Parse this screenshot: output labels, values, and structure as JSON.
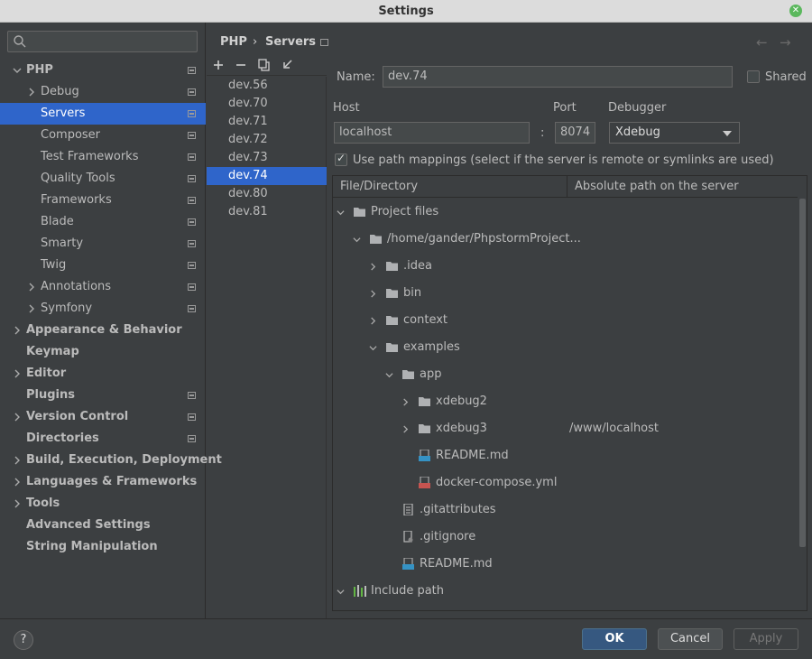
{
  "window": {
    "title": "Settings"
  },
  "sidebar": {
    "items": [
      {
        "label": "PHP",
        "bold": true,
        "indent": 0,
        "arrow": "down",
        "page_icon": true
      },
      {
        "label": "Debug",
        "bold": false,
        "indent": 1,
        "arrow": "right",
        "page_icon": true
      },
      {
        "label": "Servers",
        "bold": false,
        "indent": 1,
        "arrow": "",
        "page_icon": true,
        "selected": true
      },
      {
        "label": "Composer",
        "bold": false,
        "indent": 1,
        "arrow": "",
        "page_icon": true
      },
      {
        "label": "Test Frameworks",
        "bold": false,
        "indent": 1,
        "arrow": "",
        "page_icon": true
      },
      {
        "label": "Quality Tools",
        "bold": false,
        "indent": 1,
        "arrow": "",
        "page_icon": true
      },
      {
        "label": "Frameworks",
        "bold": false,
        "indent": 1,
        "arrow": "",
        "page_icon": true
      },
      {
        "label": "Blade",
        "bold": false,
        "indent": 1,
        "arrow": "",
        "page_icon": true
      },
      {
        "label": "Smarty",
        "bold": false,
        "indent": 1,
        "arrow": "",
        "page_icon": true
      },
      {
        "label": "Twig",
        "bold": false,
        "indent": 1,
        "arrow": "",
        "page_icon": true
      },
      {
        "label": "Annotations",
        "bold": false,
        "indent": 1,
        "arrow": "right",
        "page_icon": true
      },
      {
        "label": "Symfony",
        "bold": false,
        "indent": 1,
        "arrow": "right",
        "page_icon": true
      },
      {
        "label": "Appearance & Behavior",
        "bold": true,
        "indent": 0,
        "arrow": "right",
        "page_icon": false
      },
      {
        "label": "Keymap",
        "bold": true,
        "indent": 0,
        "arrow": "",
        "page_icon": false
      },
      {
        "label": "Editor",
        "bold": true,
        "indent": 0,
        "arrow": "right",
        "page_icon": false
      },
      {
        "label": "Plugins",
        "bold": true,
        "indent": 0,
        "arrow": "",
        "page_icon": true
      },
      {
        "label": "Version Control",
        "bold": true,
        "indent": 0,
        "arrow": "right",
        "page_icon": true
      },
      {
        "label": "Directories",
        "bold": true,
        "indent": 0,
        "arrow": "",
        "page_icon": true
      },
      {
        "label": "Build, Execution, Deployment",
        "bold": true,
        "indent": 0,
        "arrow": "right",
        "page_icon": false
      },
      {
        "label": "Languages & Frameworks",
        "bold": true,
        "indent": 0,
        "arrow": "right",
        "page_icon": false
      },
      {
        "label": "Tools",
        "bold": true,
        "indent": 0,
        "arrow": "right",
        "page_icon": false
      },
      {
        "label": "Advanced Settings",
        "bold": true,
        "indent": 0,
        "arrow": "",
        "page_icon": false
      },
      {
        "label": "String Manipulation",
        "bold": true,
        "indent": 0,
        "arrow": "",
        "page_icon": false
      }
    ]
  },
  "breadcrumb": {
    "parent": "PHP",
    "sep": "›",
    "current": "Servers"
  },
  "servers": [
    "dev.56",
    "dev.70",
    "dev.71",
    "dev.72",
    "dev.73",
    "dev.74",
    "dev.80",
    "dev.81"
  ],
  "selected_server_index": 5,
  "form": {
    "name_label": "Name:",
    "name_value": "dev.74",
    "shared_label": "Shared",
    "host_label": "Host",
    "host_value": "localhost",
    "port_label": "Port",
    "colon": ":",
    "port_value": "8074",
    "debugger_label": "Debugger",
    "debugger_value": "Xdebug",
    "path_mappings_label": "Use path mappings (select if the server is remote or symlinks are used)"
  },
  "mapping_table": {
    "col1": "File/Directory",
    "col2": "Absolute path on the server",
    "rows": [
      {
        "label": "Project files",
        "level": 0,
        "arrow": "down",
        "icon": "folder",
        "mapping": ""
      },
      {
        "label": "/home/gander/PhpstormProject...",
        "level": 1,
        "arrow": "down",
        "icon": "folder",
        "mapping": ""
      },
      {
        "label": ".idea",
        "level": 2,
        "arrow": "right",
        "icon": "folder",
        "mapping": ""
      },
      {
        "label": "bin",
        "level": 2,
        "arrow": "right",
        "icon": "folder",
        "mapping": ""
      },
      {
        "label": "context",
        "level": 2,
        "arrow": "right",
        "icon": "folder",
        "mapping": ""
      },
      {
        "label": "examples",
        "level": 2,
        "arrow": "down",
        "icon": "folder",
        "mapping": ""
      },
      {
        "label": "app",
        "level": 3,
        "arrow": "down",
        "icon": "folder",
        "mapping": ""
      },
      {
        "label": "xdebug2",
        "level": 4,
        "arrow": "right",
        "icon": "folder",
        "mapping": ""
      },
      {
        "label": "xdebug3",
        "level": 4,
        "arrow": "right",
        "icon": "folder",
        "mapping": "/www/localhost"
      },
      {
        "label": "README.md",
        "level": 4,
        "arrow": "",
        "icon": "md",
        "mapping": ""
      },
      {
        "label": "docker-compose.yml",
        "level": 4,
        "arrow": "",
        "icon": "yml",
        "mapping": ""
      },
      {
        "label": ".gitattributes",
        "level": 3,
        "arrow": "",
        "icon": "text",
        "mapping": ""
      },
      {
        "label": ".gitignore",
        "level": 3,
        "arrow": "",
        "icon": "gitignore",
        "mapping": ""
      },
      {
        "label": "README.md",
        "level": 3,
        "arrow": "",
        "icon": "md",
        "mapping": ""
      },
      {
        "label": "Include path",
        "level": 0,
        "arrow": "down",
        "icon": "library",
        "mapping": ""
      }
    ]
  },
  "buttons": {
    "help": "?",
    "ok": "OK",
    "cancel": "Cancel",
    "apply": "Apply"
  },
  "colors": {
    "selection": "#2f65ca",
    "folder": "#afb1b3",
    "md_icon": "#3592c4",
    "yml_icon": "#c75450",
    "library": "#62b543"
  }
}
